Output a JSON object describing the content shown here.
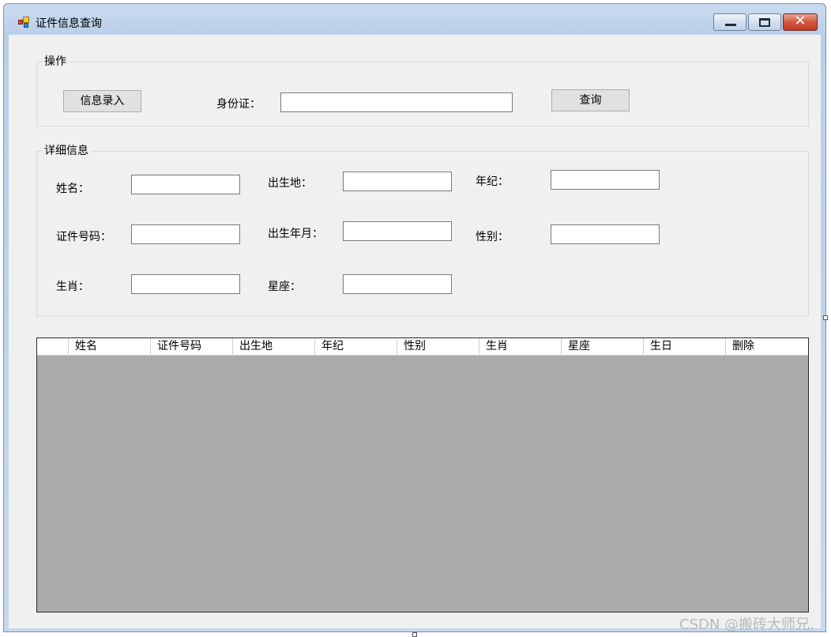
{
  "window": {
    "title": "证件信息查询",
    "icon": "app-icon"
  },
  "controls": {
    "minimize": "minimize-icon",
    "maximize": "maximize-icon",
    "close": "✕"
  },
  "operation": {
    "group_title": "操作",
    "entry_button": "信息录入",
    "id_label": "身份证：",
    "id_value": "",
    "query_button": "查询"
  },
  "details": {
    "group_title": "详细信息",
    "name_label": "姓名：",
    "birthplace_label": "出生地：",
    "age_label": "年纪：",
    "idnum_label": "证件号码：",
    "birthdate_label": "出生年月：",
    "gender_label": "性别：",
    "zodiac_label": "生肖：",
    "constellation_label": "星座：",
    "name_value": "",
    "birthplace_value": "",
    "age_value": "",
    "idnum_value": "",
    "birthdate_value": "",
    "gender_value": "",
    "zodiac_value": "",
    "constellation_value": ""
  },
  "grid": {
    "columns": [
      "姓名",
      "证件号码",
      "出生地",
      "年纪",
      "性别",
      "生肖",
      "星座",
      "生日",
      "删除"
    ]
  },
  "watermark": "CSDN @搬砖大师兄."
}
